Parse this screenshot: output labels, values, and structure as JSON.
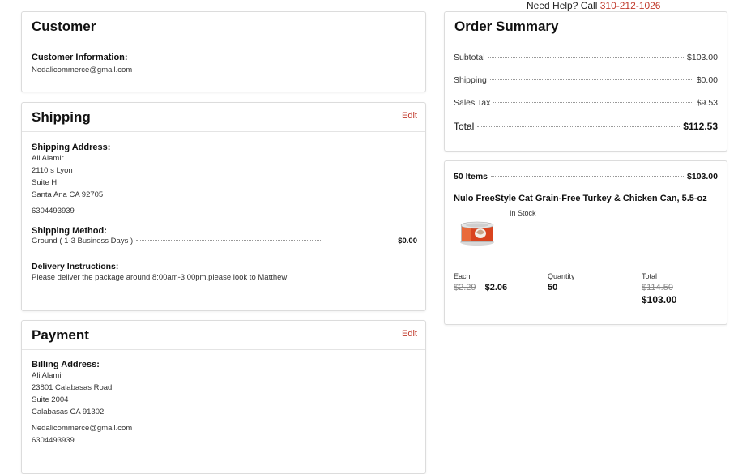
{
  "help": {
    "label": "Need Help? Call",
    "phone": "310-212-1026"
  },
  "customer": {
    "title": "Customer",
    "info_label": "Customer Information:",
    "email": "Nedalicommerce@gmail.com"
  },
  "shipping": {
    "title": "Shipping",
    "edit_label": "Edit",
    "address_label": "Shipping Address:",
    "address_lines": [
      "Ali Alamir",
      "2110 s Lyon",
      "Suite H",
      "Santa Ana CA 92705"
    ],
    "phone": "6304493939",
    "method_label": "Shipping Method:",
    "method_name": "Ground ( 1-3 Business Days )",
    "method_price": "$0.00",
    "instructions_label": "Delivery Instructions:",
    "instructions": "Please deliver the package around 8:00am-3:00pm.please look to Matthew"
  },
  "payment": {
    "title": "Payment",
    "edit_label": "Edit",
    "billing_label": "Billing Address:",
    "address_lines": [
      "Ali Alamir",
      "23801 Calabasas Road",
      "Suite 2004",
      "Calabasas CA 91302"
    ],
    "email": "Nedalicommerce@gmail.com",
    "phone": "6304493939"
  },
  "summary": {
    "title": "Order Summary",
    "subtotal_label": "Subtotal",
    "subtotal": "$103.00",
    "shipping_label": "Shipping",
    "shipping": "$0.00",
    "tax_label": "Sales Tax",
    "tax": "$9.53",
    "total_label": "Total",
    "total": "$112.53"
  },
  "items": {
    "count_label": "50 Items",
    "count_total": "$103.00",
    "product_name": "Nulo FreeStyle Cat Grain-Free Turkey & Chicken Can, 5.5-oz",
    "stock": "In Stock",
    "each_label": "Each",
    "each_old": "$2.29",
    "each_new": "$2.06",
    "qty_label": "Quantity",
    "qty": "50",
    "line_total_label": "Total",
    "line_total_old": "$114.50",
    "line_total_new": "$103.00"
  },
  "colors": {
    "accent": "#c0392b",
    "border": "#dcdcdc"
  }
}
